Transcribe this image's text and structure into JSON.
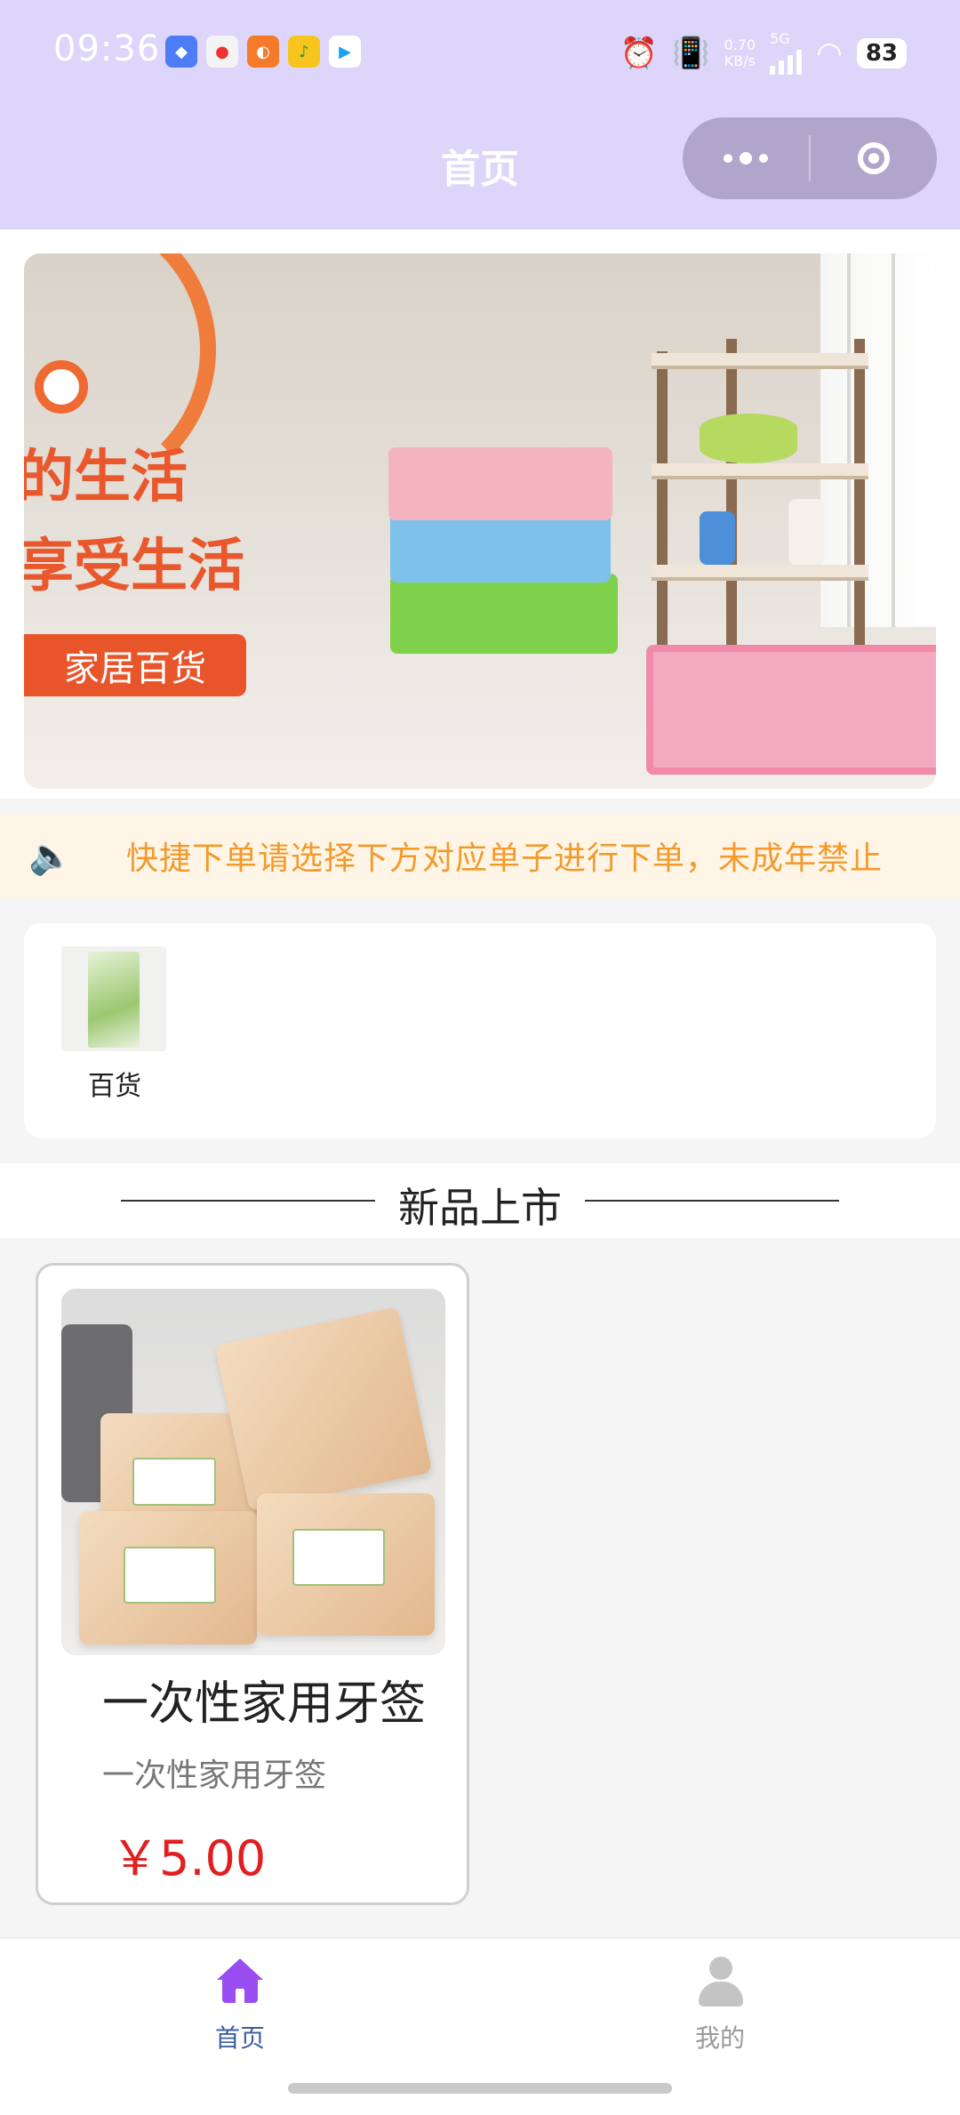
{
  "status_bar": {
    "time": "09:36",
    "net_speed_value": "0.70",
    "net_speed_unit": "KB/s",
    "network": "5G",
    "battery": "83"
  },
  "nav": {
    "title": "首页"
  },
  "banner": {
    "line1": "的生活",
    "line2": "享受生活",
    "tag": "家居百货"
  },
  "notice": {
    "text": "快捷下单请选择下方对应单子进行下单，未成年禁止"
  },
  "categories": [
    {
      "label": "百货"
    }
  ],
  "section": {
    "title": "新品上市"
  },
  "products": [
    {
      "name": "一次性家用牙签",
      "desc": "一次性家用牙签",
      "price": "￥5.00"
    }
  ],
  "tabbar": {
    "items": [
      {
        "label": "首页",
        "active": true,
        "color": "#3d5f9e"
      },
      {
        "label": "我的",
        "active": false,
        "color": "#999999"
      }
    ]
  },
  "colors": {
    "header_bg": "#ddd6fa",
    "accent_purple": "#9a4df0",
    "notice_text": "#f39a2b",
    "price": "#e02020"
  }
}
